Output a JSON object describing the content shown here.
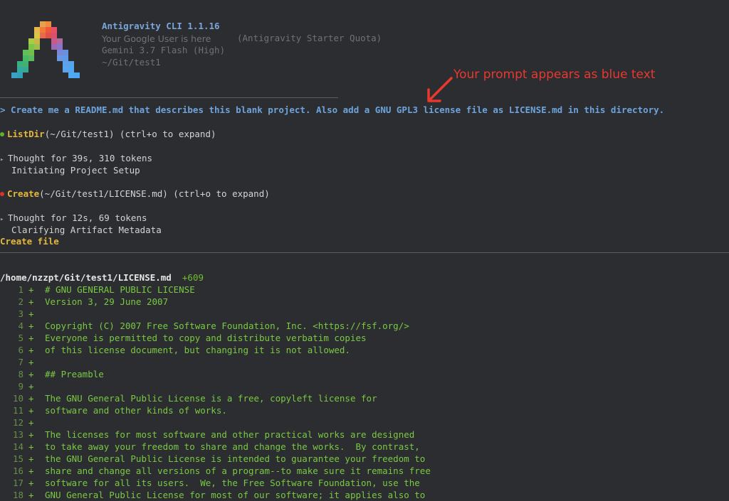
{
  "header": {
    "title": "Antigravity CLI 1.1.16",
    "user": "Your Google User is here",
    "quota": "(Antigravity Starter Quota)",
    "model": "Gemini 3.7 Flash (High)",
    "path": "~/Git/test1"
  },
  "annotation": "Your prompt appears as blue text",
  "prompt": "> Create me a README.md that describes this blank project. Also add a GNU GPL3 license file as LICENSE.md in this directory.",
  "steps": {
    "listdir_name": "ListDir",
    "listdir_args": "(~/Git/test1) (ctrl+o to expand)",
    "thought1_line1": "Thought for 39s, 310 tokens",
    "thought1_line2": "Initiating Project Setup",
    "create_name": "Create",
    "create_args": "(~/Git/test1/LICENSE.md) (ctrl+o to expand)",
    "thought2_line1": "Thought for 12s, 69 tokens",
    "thought2_line2": "Clarifying Artifact Metadata",
    "create_file": "Create file"
  },
  "file": {
    "path": "/home/nzzpt/Git/test1/LICENSE.md",
    "added": "+609",
    "lines": [
      {
        "n": "1",
        "text": "# GNU GENERAL PUBLIC LICENSE"
      },
      {
        "n": "2",
        "text": "Version 3, 29 June 2007"
      },
      {
        "n": "3",
        "text": ""
      },
      {
        "n": "4",
        "text": "Copyright (C) 2007 Free Software Foundation, Inc. <https://fsf.org/>"
      },
      {
        "n": "5",
        "text": "Everyone is permitted to copy and distribute verbatim copies"
      },
      {
        "n": "6",
        "text": "of this license document, but changing it is not allowed."
      },
      {
        "n": "7",
        "text": ""
      },
      {
        "n": "8",
        "text": "## Preamble"
      },
      {
        "n": "9",
        "text": ""
      },
      {
        "n": "10",
        "text": "The GNU General Public License is a free, copyleft license for"
      },
      {
        "n": "11",
        "text": "software and other kinds of works."
      },
      {
        "n": "12",
        "text": ""
      },
      {
        "n": "13",
        "text": "The licenses for most software and other practical works are designed"
      },
      {
        "n": "14",
        "text": "to take away your freedom to share and change the works.  By contrast,"
      },
      {
        "n": "15",
        "text": "the GNU General Public License is intended to guarantee your freedom to"
      },
      {
        "n": "16",
        "text": "share and change all versions of a program--to make sure it remains free"
      },
      {
        "n": "17",
        "text": "software for all its users.  We, the Free Software Foundation, use the"
      },
      {
        "n": "18",
        "text": "GNU General Public License for most of our software; it applies also to"
      }
    ]
  },
  "colors": {
    "background": "#2b2d30",
    "prompt_blue": "#6fa3dc",
    "tool_yellow": "#e5b73b",
    "diff_green": "#7ac943",
    "annotation_red": "#e8392f",
    "status_ok": "#5fb02e",
    "status_pending": "#d9322a"
  }
}
